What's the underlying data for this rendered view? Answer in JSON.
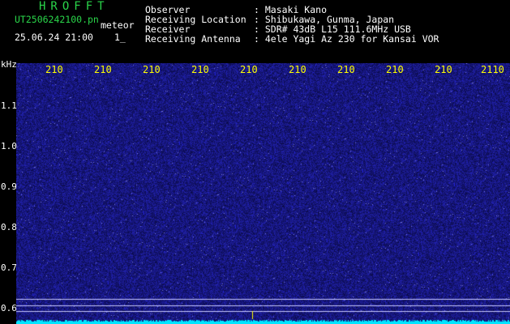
{
  "header": {
    "logo": "HROFFT",
    "file_name": "UT2506242100.pn",
    "mode": "meteor",
    "datetime": "25.06.24 21:00",
    "datetime_suffix": "1_",
    "info": [
      {
        "label": "Observer",
        "value": ": Masaki Kano"
      },
      {
        "label": "Receiving Location",
        "value": ": Shibukawa, Gunma, Japan"
      },
      {
        "label": "Receiver",
        "value": ": SDR# 43dB L15 111.6MHz USB"
      },
      {
        "label": "Receiving Antenna",
        "value": ": 4ele Yagi Az 230 for Kansai VOR"
      }
    ]
  },
  "y_axis": {
    "unit": "kHz",
    "ticks": [
      "1.1",
      "1.0",
      "0.9",
      "0.8",
      "0.7",
      "0.6"
    ]
  },
  "x_axis": {
    "ticks": [
      "210",
      "210",
      "210",
      "210",
      "210",
      "210",
      "210",
      "210",
      "210",
      "2110"
    ]
  },
  "colors": {
    "background": "#000000",
    "plot_noise": "#1a1f9a",
    "signal": "#00ffff",
    "text_green": "#2ad64a",
    "text_yellow": "#ffff00"
  }
}
